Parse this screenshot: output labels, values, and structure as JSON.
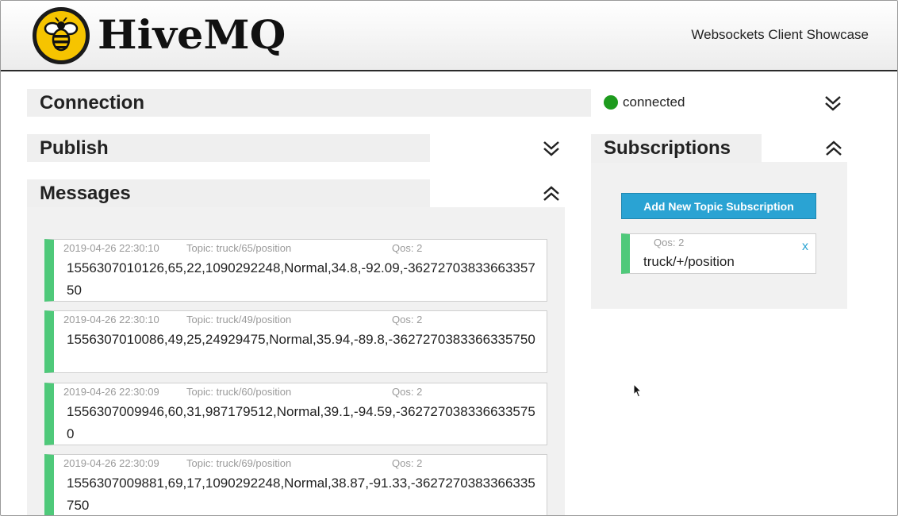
{
  "header": {
    "logo_text": "HiveMQ",
    "subtitle": "Websockets Client Showcase"
  },
  "connection": {
    "title": "Connection",
    "status": "connected",
    "status_color": "#1e9b1e",
    "toggle_icon": "chevron-double-down-icon"
  },
  "publish": {
    "title": "Publish",
    "toggle_icon": "chevron-double-down-icon"
  },
  "messages": {
    "title": "Messages",
    "toggle_icon": "chevron-double-up-icon",
    "items": [
      {
        "time": "2019-04-26 22:30:10",
        "topic": "Topic: truck/65/position",
        "qos": "Qos: 2",
        "payload": "1556307010126,65,22,1090292248,Normal,34.8,-92.09,-3627270383366335750"
      },
      {
        "time": "2019-04-26 22:30:10",
        "topic": "Topic: truck/49/position",
        "qos": "Qos: 2",
        "payload": "1556307010086,49,25,24929475,Normal,35.94,-89.8,-3627270383366335750"
      },
      {
        "time": "2019-04-26 22:30:09",
        "topic": "Topic: truck/60/position",
        "qos": "Qos: 2",
        "payload": "1556307009946,60,31,987179512,Normal,39.1,-94.59,-3627270383366335750"
      },
      {
        "time": "2019-04-26 22:30:09",
        "topic": "Topic: truck/69/position",
        "qos": "Qos: 2",
        "payload": "1556307009881,69,17,1090292248,Normal,38.87,-91.33,-3627270383366335750"
      }
    ]
  },
  "subscriptions": {
    "title": "Subscriptions",
    "toggle_icon": "chevron-double-up-icon",
    "add_button": "Add New Topic Subscription",
    "items": [
      {
        "qos": "Qos: 2",
        "topic": "truck/+/position",
        "remove": "x"
      }
    ]
  },
  "colors": {
    "accent": "#2aa3d3",
    "message_bar": "#4fc97a",
    "logo_yellow": "#f6c400"
  }
}
